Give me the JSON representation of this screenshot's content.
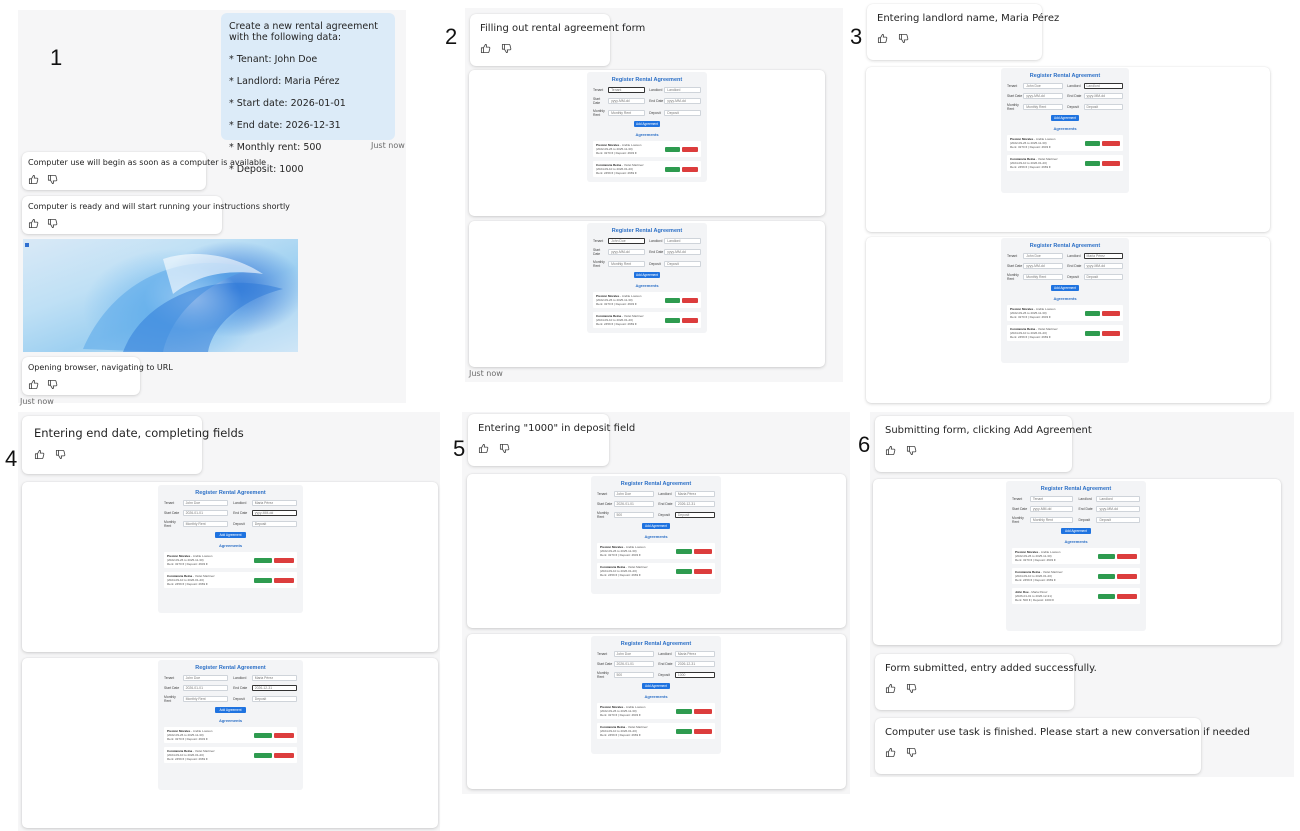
{
  "steps": [
    {
      "number": "1"
    },
    {
      "number": "2"
    },
    {
      "number": "3"
    },
    {
      "number": "4"
    },
    {
      "number": "5"
    },
    {
      "number": "6"
    }
  ],
  "step1": {
    "user_message_lines": [
      "Create a new rental agreement with the following data:",
      "* Tenant: John Doe",
      "* Landlord: Maria Pérez",
      "* Start date: 2026-01-01",
      "* End date: 2026-12-31",
      "* Monthly rent: 500",
      "* Deposit: 1000"
    ],
    "user_timestamp": "Just now",
    "status_available": "Computer use will begin as soon as a computer is available",
    "status_ready": "Computer is ready and will start running your instructions shortly",
    "status_browser": "Opening browser, navigating to URL",
    "timestamp": "Just now"
  },
  "step2": {
    "status": "Filling out rental agreement form",
    "timestamp": "Just now"
  },
  "step3": {
    "status": "Entering landlord name, Maria Pérez"
  },
  "step4": {
    "status": "Entering end date, completing fields"
  },
  "step5": {
    "status": "Entering \"1000\" in deposit field"
  },
  "step6": {
    "status": "Submitting form, clicking Add Agreement",
    "submitted": "Form submitted, entry added successfully.",
    "finished": "Computer use task is finished. Please start a new conversation if needed"
  },
  "form": {
    "title": "Register Rental Agreement",
    "tenant_label": "Tenant",
    "landlord_label": "Landlord",
    "start_label": "Start Date",
    "end_label": "End Date",
    "rent_label": "Monthly Rent",
    "deposit_label": "Deposit",
    "tenant_placeholder": "Tenant",
    "landlord_placeholder": "Landlord",
    "date_placeholder": "yyyy-MM-dd",
    "rent_placeholder": "Monthly Rent",
    "deposit_placeholder": "Deposit",
    "add_button": "Add Agreement",
    "agreements_heading": "Agreements",
    "agreements": [
      {
        "tenant": "Preston Morales",
        "landlord": "Andile Lowson",
        "dates": "(2022-09-26 to 2025-11-30)",
        "rent": "Rent: 3270 € | Deposit: 4603 €"
      },
      {
        "tenant": "Constancia Reina",
        "landlord": "Violet Martinez",
        "dates": "(2024-09-10 to 2026-01-20)",
        "rent": "Rent: 2459 € | Deposit: 2669 €"
      },
      {
        "tenant": "John Doe",
        "landlord": "Maria Pérez",
        "dates": "(2026-01-01 to 2026-12-31)",
        "rent": "Rent: 500 € | Deposit: 1000 €"
      }
    ],
    "values": {
      "tenant": "John Doe",
      "landlord": "Maria Pérez",
      "start": "2026-01-01",
      "end": "2026-12-31",
      "rent": "500",
      "deposit": "1000"
    }
  },
  "colors": {
    "user_bubble": "#dcebf8",
    "form_title": "#2b6fc6",
    "primary_button": "#1f73e0",
    "edit_button": "#2e9b4f",
    "delete_button": "#dc3d3d"
  }
}
